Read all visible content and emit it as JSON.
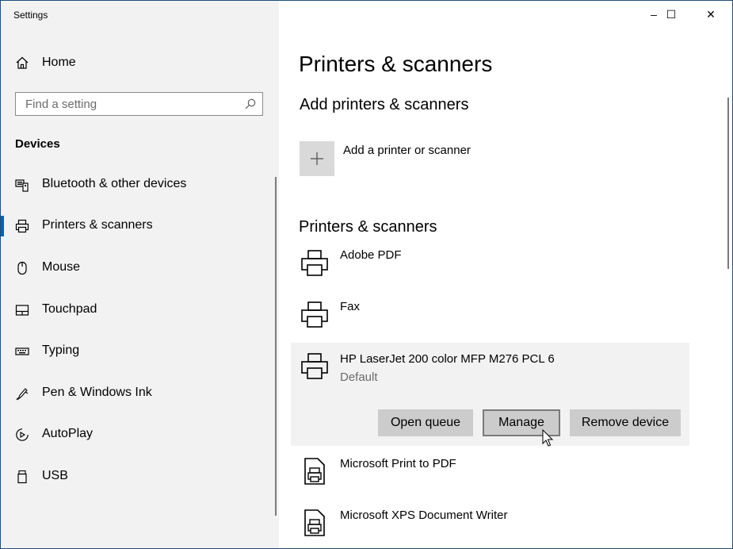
{
  "window": {
    "title": "Settings",
    "controls": {
      "minimize": "–",
      "maximize": "☐",
      "close": "✕"
    }
  },
  "sidebar": {
    "home_label": "Home",
    "search_placeholder": "Find a setting",
    "section_label": "Devices",
    "items": [
      {
        "label": "Bluetooth & other devices",
        "icon": "bluetooth-devices-icon"
      },
      {
        "label": "Printers & scanners",
        "icon": "printer-icon",
        "active": true
      },
      {
        "label": "Mouse",
        "icon": "mouse-icon"
      },
      {
        "label": "Touchpad",
        "icon": "touchpad-icon"
      },
      {
        "label": "Typing",
        "icon": "keyboard-icon"
      },
      {
        "label": "Pen & Windows Ink",
        "icon": "pen-icon"
      },
      {
        "label": "AutoPlay",
        "icon": "autoplay-icon"
      },
      {
        "label": "USB",
        "icon": "usb-icon"
      }
    ]
  },
  "main": {
    "page_title": "Printers & scanners",
    "add_section_title": "Add printers & scanners",
    "add_label": "Add a printer or scanner",
    "list_title": "Printers & scanners",
    "printers": [
      {
        "name": "Adobe PDF"
      },
      {
        "name": "Fax"
      },
      {
        "name": "HP LaserJet 200 color MFP M276 PCL 6",
        "status": "Default"
      },
      {
        "name": "Microsoft Print to PDF"
      },
      {
        "name": "Microsoft XPS Document Writer"
      }
    ],
    "actions": {
      "open_queue": "Open queue",
      "manage": "Manage",
      "remove_device": "Remove device"
    }
  },
  "colors": {
    "accent": "#0063b1",
    "sidebar_bg": "#f2f2f2",
    "button_bg": "#cccccc",
    "selected_bg": "#f2f2f2"
  }
}
